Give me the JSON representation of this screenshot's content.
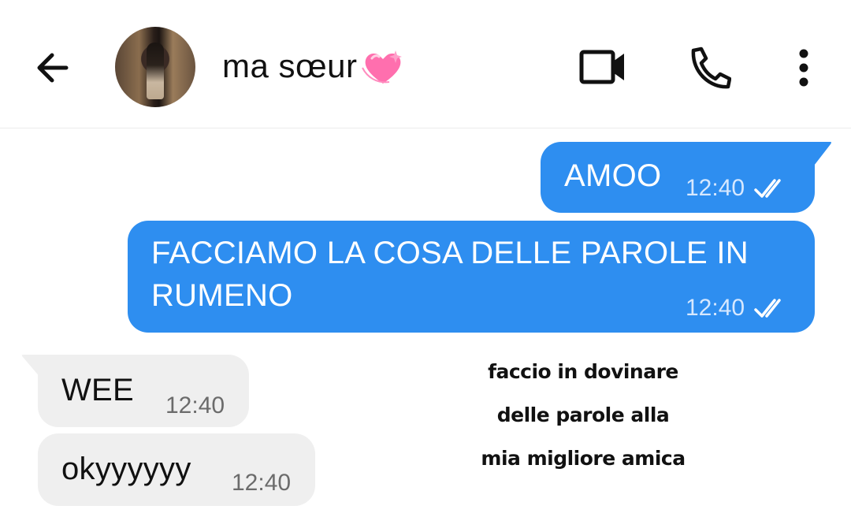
{
  "header": {
    "contact_name": "ma sœur",
    "back_icon": "arrow-left-icon",
    "status_emoji": "sparkling-heart-icon",
    "video_icon": "video-camera-icon",
    "call_icon": "phone-icon",
    "menu_icon": "more-vertical-icon"
  },
  "messages": [
    {
      "direction": "outgoing",
      "text": "AMOO",
      "time": "12:40",
      "status": "read"
    },
    {
      "direction": "outgoing",
      "text": "FACCIAMO LA COSA DELLE PAROLE IN RUMENO",
      "time": "12:40",
      "status": "read"
    },
    {
      "direction": "incoming",
      "text": "WEE",
      "time": "12:40"
    },
    {
      "direction": "incoming",
      "text": "okyyyyyy",
      "time": "12:40"
    }
  ],
  "caption": {
    "lines": [
      "faccio in dovinare",
      "delle parole alla",
      "mia migliore amica"
    ]
  },
  "colors": {
    "outgoing_bubble": "#2e8ef0",
    "incoming_bubble": "#efefef",
    "heart": "#ff5fa2"
  }
}
